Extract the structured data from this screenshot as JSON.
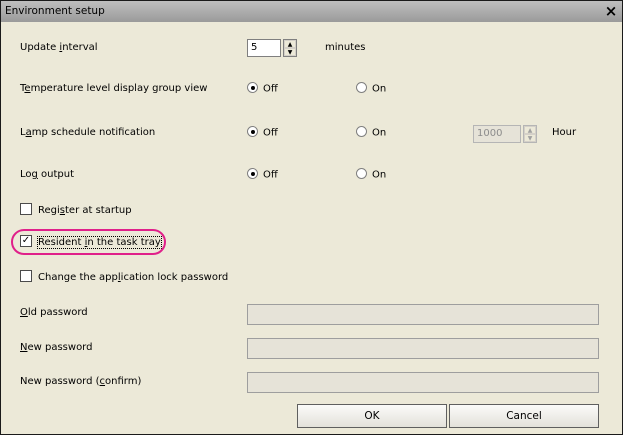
{
  "window": {
    "title": "Environment setup",
    "close_glyph": "×"
  },
  "update_interval": {
    "label_pre": "Update ",
    "label_u": "i",
    "label_post": "nterval",
    "value": "5",
    "unit": "minutes"
  },
  "temp_level": {
    "label_pre": "T",
    "label_u": "e",
    "label_post": "mperature level display group view",
    "off": "Off",
    "on": "On",
    "selected": "Off"
  },
  "lamp_schedule": {
    "label_pre": "L",
    "label_u": "a",
    "label_post": "mp schedule notification",
    "off": "Off",
    "on": "On",
    "selected": "Off",
    "value": "1000",
    "unit": "Hour"
  },
  "log_output": {
    "label_pre": "Lo",
    "label_u": "g",
    "label_post": " output",
    "off": "Off",
    "on": "On",
    "selected": "Off"
  },
  "register_startup": {
    "label_pre": "Regi",
    "label_u": "s",
    "label_post": "ter at startup",
    "checked": false
  },
  "resident_tray": {
    "label_pre": "Resident ",
    "label_u": "i",
    "label_post": "n the task tray",
    "checked": true,
    "check_glyph": "✓"
  },
  "change_lock": {
    "label_pre": "Change the app",
    "label_u": "l",
    "label_post": "ication lock password",
    "checked": false
  },
  "old_password": {
    "label_u": "O",
    "label_post": "ld password",
    "value": ""
  },
  "new_password": {
    "label_u": "N",
    "label_post": "ew password",
    "value": ""
  },
  "confirm_password": {
    "label_pre": "New password (",
    "label_u": "c",
    "label_post": "onfirm)",
    "value": ""
  },
  "buttons": {
    "ok": "OK",
    "cancel": "Cancel"
  },
  "colors": {
    "highlight": "#e0208a",
    "window_bg": "#ece9d8"
  },
  "icons": {
    "spin_up": "▲",
    "spin_down": "▼"
  }
}
